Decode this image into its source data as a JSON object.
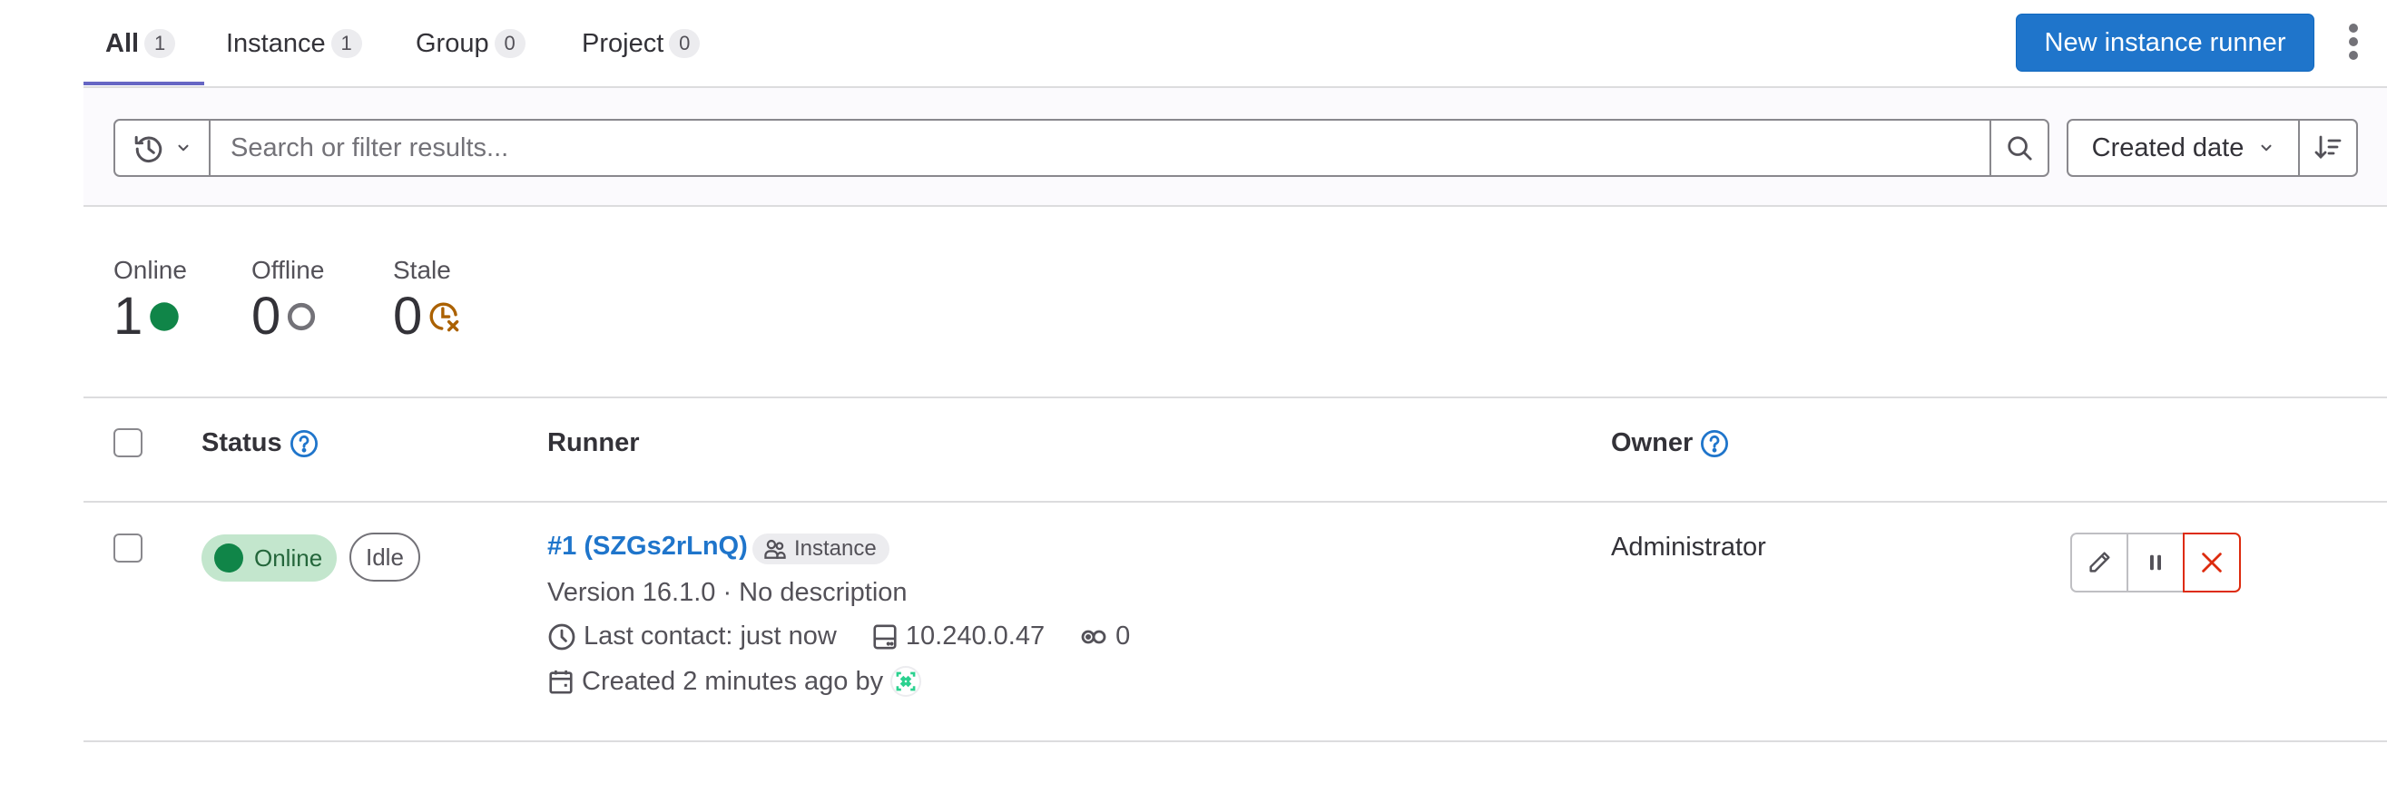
{
  "tabs": [
    {
      "label": "All",
      "count": "1",
      "active": true
    },
    {
      "label": "Instance",
      "count": "1",
      "active": false
    },
    {
      "label": "Group",
      "count": "0",
      "active": false
    },
    {
      "label": "Project",
      "count": "0",
      "active": false
    }
  ],
  "header": {
    "new_runner_label": "New instance runner",
    "more_actions_icon": "kebab-vertical-icon"
  },
  "filter": {
    "history_icon": "history-icon",
    "search_placeholder": "Search or filter results...",
    "search_value": "",
    "search_icon": "search-icon",
    "sort_selected": "Created date",
    "sort_direction_icon": "sort-descending-icon"
  },
  "stats": [
    {
      "label": "Online",
      "value": "1",
      "icon": "status-online-dot",
      "color": "#108548"
    },
    {
      "label": "Offline",
      "value": "0",
      "icon": "status-offline-ring",
      "color": "#737278"
    },
    {
      "label": "Stale",
      "value": "0",
      "icon": "status-stale-clock",
      "color": "#ab6100"
    }
  ],
  "table": {
    "columns": [
      {
        "label": "Status",
        "help_icon": true
      },
      {
        "label": "Runner",
        "help_icon": false
      },
      {
        "label": "Owner",
        "help_icon": true
      }
    ],
    "rows": [
      {
        "status": "Online",
        "job_status": "Idle",
        "runner_name": "#1 (SZGs2rLnQ)",
        "runner_type": "Instance",
        "version_line": "Version 16.1.0 · No description",
        "last_contact": "Last contact: just now",
        "ip_address": "10.240.0.47",
        "job_count": "0",
        "created": "Created 2 minutes ago by",
        "owner": "Administrator",
        "actions": [
          "edit",
          "pause",
          "delete"
        ]
      }
    ]
  },
  "colors": {
    "primary": "#1f75cb",
    "tab_active": "#6666c4",
    "online": "#108548",
    "danger": "#dd2b0e",
    "stale": "#ab6100"
  }
}
